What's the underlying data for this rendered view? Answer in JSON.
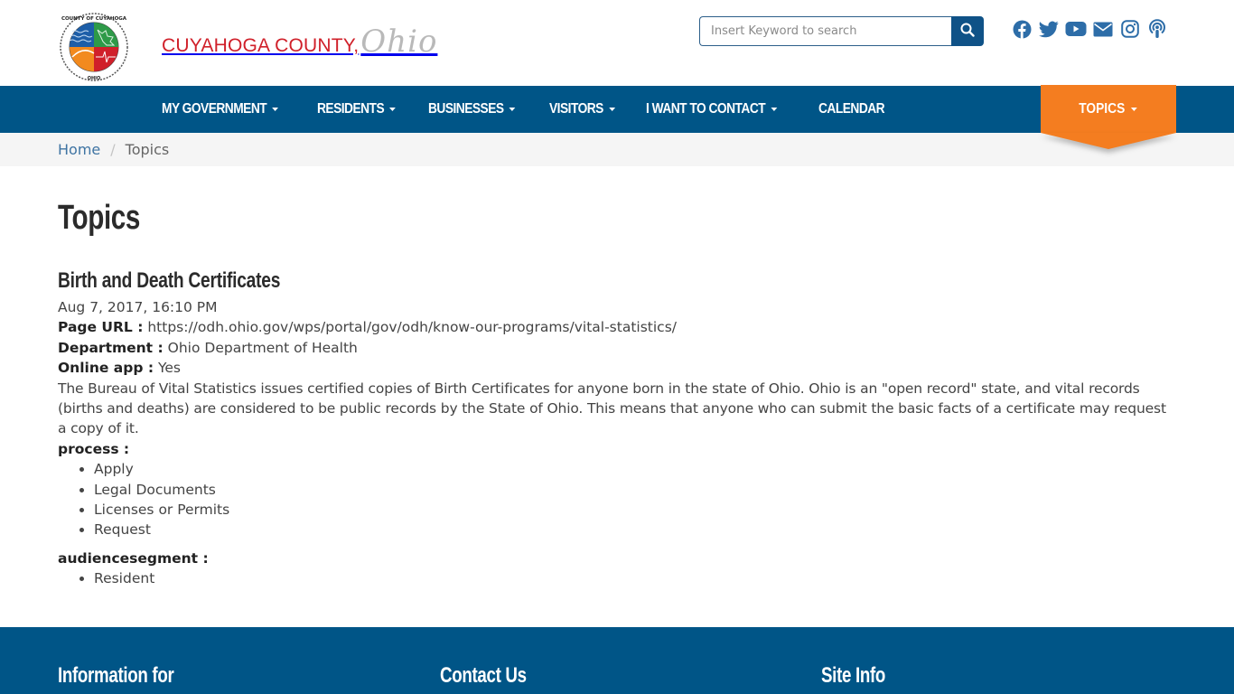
{
  "header": {
    "seal_alt": "County of Cuyahoga Ohio seal",
    "seal_text_top": "COUNTY OF CUYAHOGA",
    "seal_text_bottom": "OHIO",
    "brand_main": "CUYAHOGA COUNTY,",
    "brand_script": "Ohio",
    "search": {
      "placeholder": "Insert Keyword to search",
      "value": "",
      "button_icon": "search-icon"
    },
    "social": [
      {
        "name": "facebook",
        "icon": "facebook-icon"
      },
      {
        "name": "twitter",
        "icon": "twitter-icon"
      },
      {
        "name": "youtube",
        "icon": "youtube-icon"
      },
      {
        "name": "email",
        "icon": "envelope-icon"
      },
      {
        "name": "instagram",
        "icon": "instagram-icon"
      },
      {
        "name": "podcast",
        "icon": "podcast-icon"
      }
    ]
  },
  "nav": {
    "items": [
      {
        "label": "MY GOVERNMENT",
        "dropdown": true
      },
      {
        "label": "RESIDENTS",
        "dropdown": true
      },
      {
        "label": "BUSINESSES",
        "dropdown": true
      },
      {
        "label": "VISITORS",
        "dropdown": true
      },
      {
        "label": "I WANT TO CONTACT",
        "dropdown": true
      },
      {
        "label": "CALENDAR",
        "dropdown": false
      }
    ],
    "topics": {
      "label": "TOPICS",
      "dropdown": true
    }
  },
  "breadcrumb": {
    "items": [
      {
        "label": "Home",
        "link": true
      },
      {
        "label": "Topics",
        "link": false
      }
    ],
    "separator": "/"
  },
  "main": {
    "page_title": "Topics",
    "topic": {
      "title": "Birth and Death Certificates",
      "date": "Aug 7, 2017, 16:10 PM",
      "page_url_label": "Page URL :",
      "page_url": "https://odh.ohio.gov/wps/portal/gov/odh/know-our-programs/vital-statistics/",
      "department_label": "Department :",
      "department": "Ohio Department of Health",
      "online_app_label": "Online app :",
      "online_app": "Yes",
      "description": "The Bureau of Vital Statistics issues certified copies of Birth Certificates for anyone born in the state of Ohio. Ohio is an \"open record\" state, and vital records (births and deaths) are considered to be public records by the State of Ohio. This means that anyone who can submit the basic facts of a certificate may request a copy of it.",
      "process_label": "process :",
      "process": [
        "Apply",
        "Legal Documents",
        "Licenses or Permits",
        "Request"
      ],
      "audience_label": "audiencesegment :",
      "audience": [
        "Resident"
      ]
    }
  },
  "footer": {
    "columns": [
      {
        "title": "Information for"
      },
      {
        "title": "Contact Us"
      },
      {
        "title": "Site Info"
      }
    ]
  },
  "colors": {
    "brand_blue": "#005587",
    "accent_orange": "#f47d20",
    "brand_red": "#d0202a",
    "link_blue": "#3f74a3"
  }
}
